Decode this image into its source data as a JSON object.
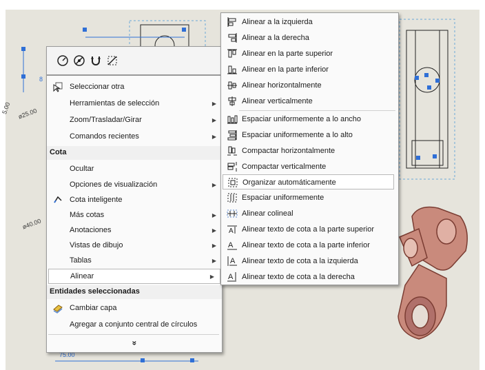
{
  "drawing": {
    "dims": [
      "5.00",
      "ø25.00",
      "ø40.00",
      "75.00",
      "8"
    ]
  },
  "toolbar": {
    "icons": [
      "smart-dimension-icon",
      "no-dimension-icon",
      "magnet-icon",
      "auto-dimension-icon"
    ]
  },
  "context_menu": {
    "items": [
      {
        "label": "Seleccionar otra",
        "icon": "select-other-icon",
        "arrow": false
      },
      {
        "label": "Herramientas de selección",
        "arrow": true
      },
      {
        "label": "Zoom/Trasladar/Girar",
        "arrow": true
      },
      {
        "label": "Comandos recientes",
        "arrow": true
      }
    ],
    "section1": "Cota",
    "items2": [
      {
        "label": "Ocultar",
        "arrow": false
      },
      {
        "label": "Opciones de visualización",
        "arrow": true
      },
      {
        "label": "Cota inteligente",
        "icon": "smart-dimension-icon",
        "arrow": false
      },
      {
        "label": "Más cotas",
        "arrow": true
      },
      {
        "label": "Anotaciones",
        "arrow": true
      },
      {
        "label": "Vistas de dibujo",
        "arrow": true
      },
      {
        "label": "Tablas",
        "arrow": true
      },
      {
        "label": "Alinear",
        "arrow": true
      }
    ],
    "section2": "Entidades seleccionadas",
    "items3": [
      {
        "label": "Cambiar capa",
        "icon": "layer-icon"
      },
      {
        "label": "Agregar a conjunto central de círculos"
      }
    ],
    "expand": "»"
  },
  "submenu": {
    "items": [
      {
        "label": "Alinear a la izquierda",
        "icon": "align-left-icon"
      },
      {
        "label": "Alinear a la derecha",
        "icon": "align-right-icon"
      },
      {
        "label": "Alinear en la parte superior",
        "icon": "align-top-icon"
      },
      {
        "label": "Alinear en la parte inferior",
        "icon": "align-bottom-icon"
      },
      {
        "label": "Alinear horizontalmente",
        "icon": "align-horizontal-icon"
      },
      {
        "label": "Alinear verticalmente",
        "icon": "align-vertical-icon"
      },
      {
        "label": "Espaciar uniformemente a lo ancho",
        "icon": "space-across-icon"
      },
      {
        "label": "Espaciar uniformemente a lo alto",
        "icon": "space-down-icon"
      },
      {
        "label": "Compactar horizontalmente",
        "icon": "tighten-horizontal-icon"
      },
      {
        "label": "Compactar verticalmente",
        "icon": "tighten-vertical-icon"
      },
      {
        "label": "Organizar automáticamente",
        "icon": "auto-arrange-icon"
      },
      {
        "label": "Espaciar uniformemente",
        "icon": "space-evenly-icon"
      },
      {
        "label": "Alinear colineal",
        "icon": "collinear-icon"
      },
      {
        "label": "Alinear texto de cota a la parte superior",
        "icon": "text-top-icon"
      },
      {
        "label": "Alinear texto de cota a la parte inferior",
        "icon": "text-bottom-icon"
      },
      {
        "label": "Alinear texto de cota a la izquierda",
        "icon": "text-left-icon"
      },
      {
        "label": "Alinear texto de cota a la derecha",
        "icon": "text-right-icon"
      }
    ]
  },
  "colors": {
    "part": "#c98a7c",
    "part_dark": "#8a4a40",
    "selection": "#2f6fd6"
  }
}
